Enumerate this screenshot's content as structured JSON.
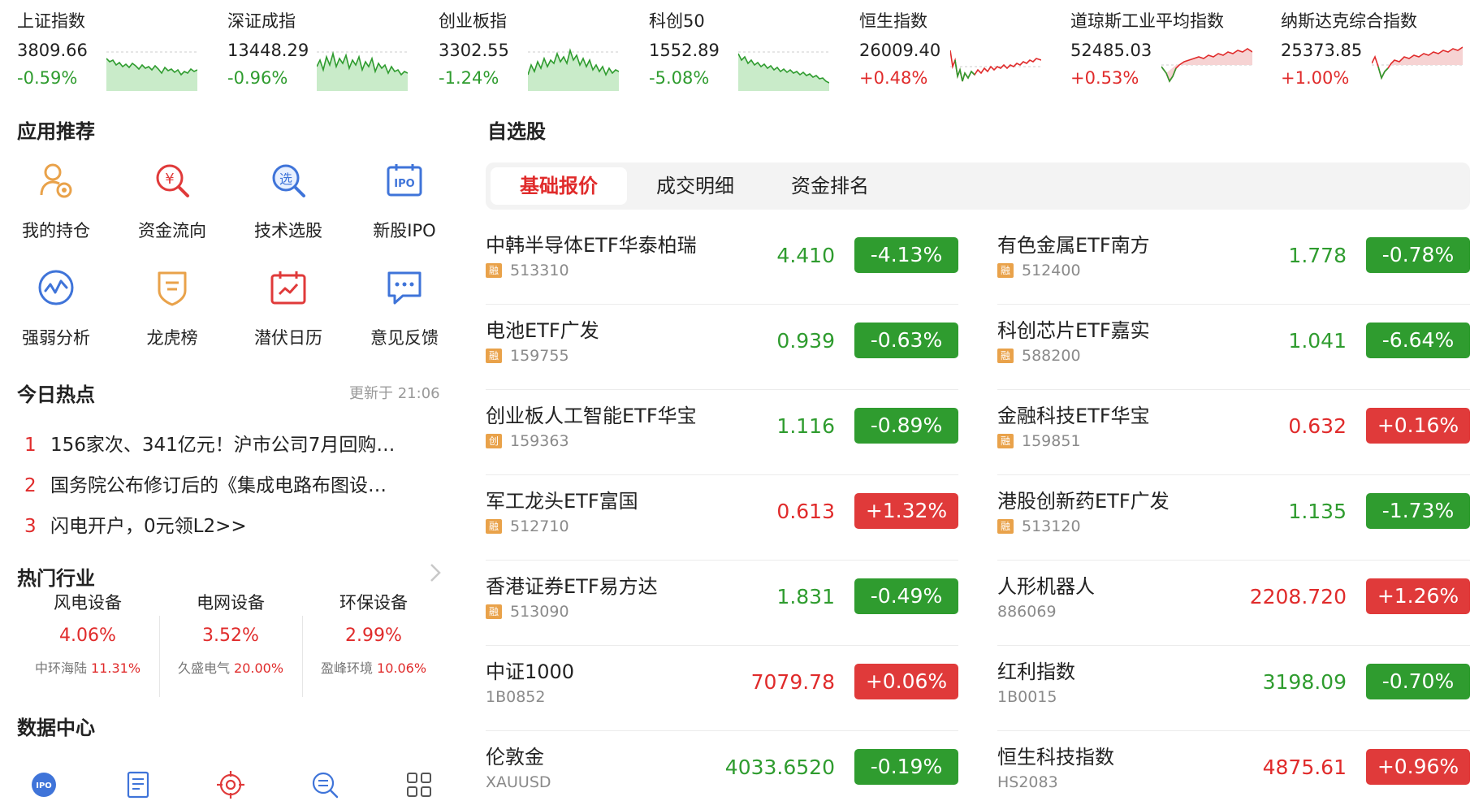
{
  "indices": [
    {
      "name": "上证指数",
      "value": "3809.66",
      "change": "-0.59%",
      "trend": "down"
    },
    {
      "name": "深证成指",
      "value": "13448.29",
      "change": "-0.96%",
      "trend": "down"
    },
    {
      "name": "创业板指",
      "value": "3302.55",
      "change": "-1.24%",
      "trend": "down"
    },
    {
      "name": "科创50",
      "value": "1552.89",
      "change": "-5.08%",
      "trend": "down"
    },
    {
      "name": "恒生指数",
      "value": "26009.40",
      "change": "+0.48%",
      "trend": "up"
    },
    {
      "name": "道琼斯工业平均指数",
      "value": "52485.03",
      "change": "+0.53%",
      "trend": "up"
    },
    {
      "name": "纳斯达克综合指数",
      "value": "25373.85",
      "change": "+1.00%",
      "trend": "up"
    }
  ],
  "apps": {
    "title": "应用推荐",
    "items": [
      {
        "label": "我的持仓",
        "icon": "holdings-icon"
      },
      {
        "label": "资金流向",
        "icon": "money-flow-icon"
      },
      {
        "label": "技术选股",
        "icon": "stock-picker-icon"
      },
      {
        "label": "新股IPO",
        "icon": "ipo-icon"
      },
      {
        "label": "强弱分析",
        "icon": "strength-analysis-icon"
      },
      {
        "label": "龙虎榜",
        "icon": "dragon-tiger-list-icon"
      },
      {
        "label": "潜伏日历",
        "icon": "calendar-icon"
      },
      {
        "label": "意见反馈",
        "icon": "feedback-icon"
      }
    ]
  },
  "hot": {
    "title": "今日热点",
    "updated": "更新于 21:06",
    "items": [
      {
        "num": "1",
        "text": "156家次、341亿元！沪市公司7月回购…"
      },
      {
        "num": "2",
        "text": "国务院公布修订后的《集成电路布图设…"
      },
      {
        "num": "3",
        "text": "闪电开户，0元领L2>>"
      }
    ]
  },
  "industries": {
    "title": "热门行业",
    "items": [
      {
        "name": "风电设备",
        "pct": "4.06%",
        "leader": "中环海陆",
        "leader_pct": "11.31%"
      },
      {
        "name": "电网设备",
        "pct": "3.52%",
        "leader": "久盛电气",
        "leader_pct": "20.00%"
      },
      {
        "name": "环保设备",
        "pct": "2.99%",
        "leader": "盈峰环境",
        "leader_pct": "10.06%"
      }
    ]
  },
  "data_center": {
    "title": "数据中心",
    "icons": [
      "ipo-circle-icon",
      "report-icon",
      "target-icon",
      "search-list-icon",
      "grid-icon"
    ],
    "ipo_text": "IPO"
  },
  "watchlist": {
    "title": "自选股",
    "tabs": [
      "基础报价",
      "成交明细",
      "资金排名"
    ],
    "active_tab": 0,
    "colors": {
      "up": "#e03a3a",
      "down": "#2f9c2f"
    },
    "left": [
      {
        "name": "中韩半导体ETF华泰柏瑞",
        "tag": "融",
        "code": "513310",
        "price": "4.410",
        "change": "-4.13%",
        "dir": "down"
      },
      {
        "name": "电池ETF广发",
        "tag": "融",
        "code": "159755",
        "price": "0.939",
        "change": "-0.63%",
        "dir": "down"
      },
      {
        "name": "创业板人工智能ETF华宝",
        "tag": "创",
        "code": "159363",
        "price": "1.116",
        "change": "-0.89%",
        "dir": "down"
      },
      {
        "name": "军工龙头ETF富国",
        "tag": "融",
        "code": "512710",
        "price": "0.613",
        "change": "+1.32%",
        "dir": "up"
      },
      {
        "name": "香港证券ETF易方达",
        "tag": "融",
        "code": "513090",
        "price": "1.831",
        "change": "-0.49%",
        "dir": "down"
      },
      {
        "name": "中证1000",
        "tag": "",
        "code": "1B0852",
        "price": "7079.78",
        "change": "+0.06%",
        "dir": "up"
      },
      {
        "name": "伦敦金",
        "tag": "",
        "code": "XAUUSD",
        "price": "4033.6520",
        "change": "-0.19%",
        "dir": "down"
      }
    ],
    "right": [
      {
        "name": "有色金属ETF南方",
        "tag": "融",
        "code": "512400",
        "price": "1.778",
        "change": "-0.78%",
        "dir": "down"
      },
      {
        "name": "科创芯片ETF嘉实",
        "tag": "融",
        "code": "588200",
        "price": "1.041",
        "change": "-6.64%",
        "dir": "down"
      },
      {
        "name": "金融科技ETF华宝",
        "tag": "融",
        "code": "159851",
        "price": "0.632",
        "change": "+0.16%",
        "dir": "up"
      },
      {
        "name": "港股创新药ETF广发",
        "tag": "融",
        "code": "513120",
        "price": "1.135",
        "change": "-1.73%",
        "dir": "down"
      },
      {
        "name": "人形机器人",
        "tag": "",
        "code": "886069",
        "price": "2208.720",
        "change": "+1.26%",
        "dir": "up"
      },
      {
        "name": "红利指数",
        "tag": "",
        "code": "1B0015",
        "price": "3198.09",
        "change": "-0.70%",
        "dir": "down"
      },
      {
        "name": "恒生科技指数",
        "tag": "",
        "code": "HS2083",
        "price": "4875.61",
        "change": "+0.96%",
        "dir": "up"
      }
    ]
  }
}
